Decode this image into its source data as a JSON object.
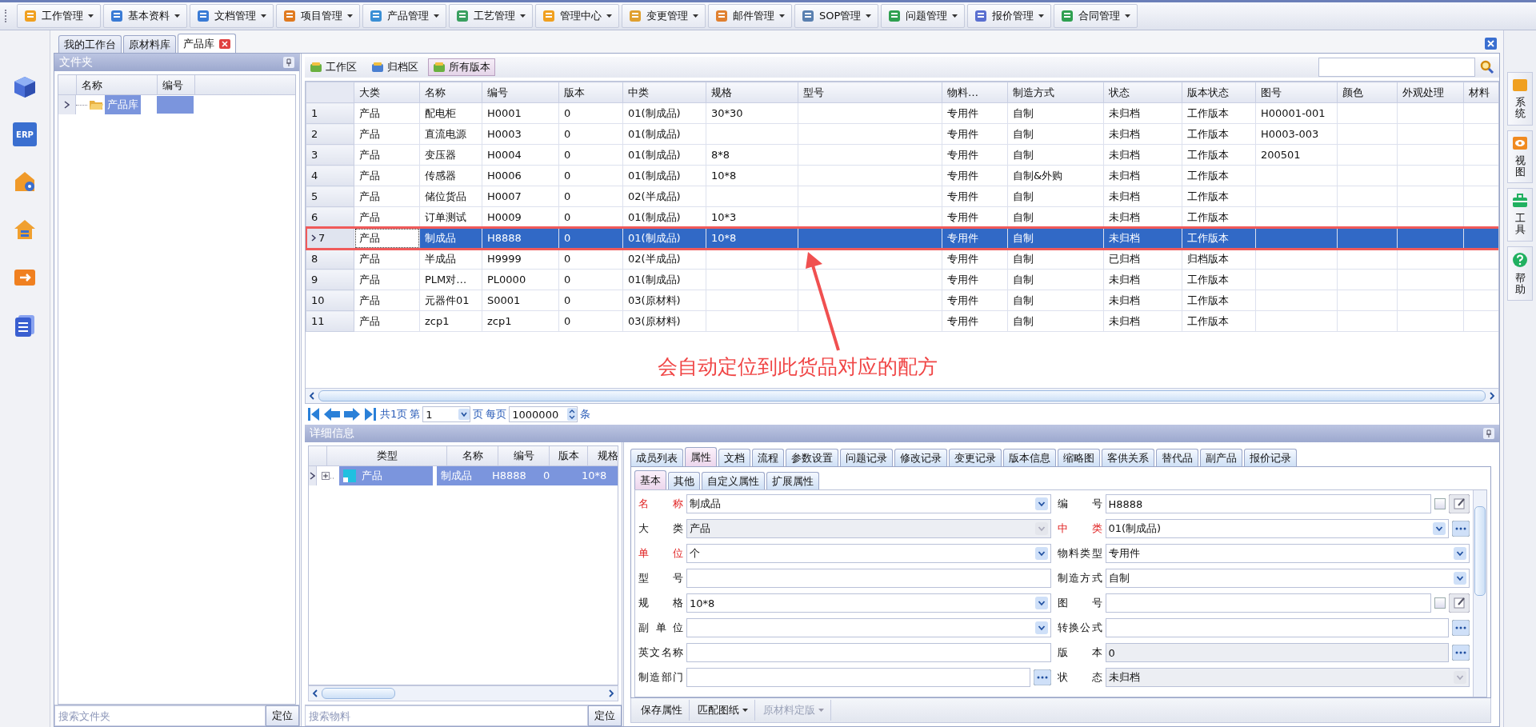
{
  "menu": [
    {
      "label": "工作管理"
    },
    {
      "label": "基本资料"
    },
    {
      "label": "文档管理"
    },
    {
      "label": "项目管理"
    },
    {
      "label": "产品管理"
    },
    {
      "label": "工艺管理"
    },
    {
      "label": "管理中心"
    },
    {
      "label": "变更管理"
    },
    {
      "label": "邮件管理"
    },
    {
      "label": "SOP管理"
    },
    {
      "label": "问题管理"
    },
    {
      "label": "报价管理"
    },
    {
      "label": "合同管理"
    }
  ],
  "left_bar": {
    "badge": "ERP"
  },
  "doc_tabs": [
    {
      "label": "我的工作台",
      "selected": false,
      "closable": false
    },
    {
      "label": "原材料库",
      "selected": false,
      "closable": false
    },
    {
      "label": "产品库",
      "selected": true,
      "closable": true
    }
  ],
  "folder_panel": {
    "title": "文件夹",
    "columns": [
      "名称",
      "编号"
    ],
    "tree": [
      {
        "label": "产品库",
        "selected": true
      }
    ],
    "search_placeholder": "搜索文件夹",
    "locate_button": "定位"
  },
  "toolbar": [
    {
      "label": "工作区",
      "selected": false
    },
    {
      "label": "归档区",
      "selected": false
    },
    {
      "label": "所有版本",
      "selected": true
    }
  ],
  "table": {
    "columns": [
      "大类",
      "名称",
      "编号",
      "版本",
      "中类",
      "规格",
      "型号",
      "物料…",
      "制造方式",
      "状态",
      "版本状态",
      "图号",
      "颜色",
      "外观处理",
      "材料"
    ],
    "rows": [
      {
        "num": "1",
        "selected": false,
        "highlighted": false,
        "cells": [
          "产品",
          "配电柜",
          "H0001",
          "0",
          "01(制成品)",
          "30*30",
          "",
          "专用件",
          "自制",
          "未归档",
          "工作版本",
          "H00001-001",
          "",
          "",
          ""
        ]
      },
      {
        "num": "2",
        "selected": false,
        "highlighted": false,
        "cells": [
          "产品",
          "直流电源",
          "H0003",
          "0",
          "01(制成品)",
          "",
          "",
          "专用件",
          "自制",
          "未归档",
          "工作版本",
          "H0003-003",
          "",
          "",
          ""
        ]
      },
      {
        "num": "3",
        "selected": false,
        "highlighted": false,
        "cells": [
          "产品",
          "变压器",
          "H0004",
          "0",
          "01(制成品)",
          "8*8",
          "",
          "专用件",
          "自制",
          "未归档",
          "工作版本",
          "200501",
          "",
          "",
          ""
        ]
      },
      {
        "num": "4",
        "selected": false,
        "highlighted": false,
        "cells": [
          "产品",
          "传感器",
          "H0006",
          "0",
          "01(制成品)",
          "10*8",
          "",
          "专用件",
          "自制&外购",
          "未归档",
          "工作版本",
          "",
          "",
          "",
          ""
        ]
      },
      {
        "num": "5",
        "selected": false,
        "highlighted": false,
        "cells": [
          "产品",
          "储位货品",
          "H0007",
          "0",
          "02(半成品)",
          "",
          "",
          "专用件",
          "自制",
          "未归档",
          "工作版本",
          "",
          "",
          "",
          ""
        ]
      },
      {
        "num": "6",
        "selected": false,
        "highlighted": false,
        "cells": [
          "产品",
          "订单测试",
          "H0009",
          "0",
          "01(制成品)",
          "10*3",
          "",
          "专用件",
          "自制",
          "未归档",
          "工作版本",
          "",
          "",
          "",
          ""
        ]
      },
      {
        "num": "7",
        "selected": true,
        "highlighted": true,
        "cells": [
          "产品",
          "制成品",
          "H8888",
          "0",
          "01(制成品)",
          "10*8",
          "",
          "专用件",
          "自制",
          "未归档",
          "工作版本",
          "",
          "",
          "",
          ""
        ]
      },
      {
        "num": "8",
        "selected": false,
        "highlighted": false,
        "cells": [
          "产品",
          "半成品",
          "H9999",
          "0",
          "02(半成品)",
          "",
          "",
          "专用件",
          "自制",
          "已归档",
          "归档版本",
          "",
          "",
          "",
          ""
        ]
      },
      {
        "num": "9",
        "selected": false,
        "highlighted": false,
        "cells": [
          "产品",
          "PLM对…",
          "PL0000",
          "0",
          "01(制成品)",
          "",
          "",
          "专用件",
          "自制",
          "未归档",
          "工作版本",
          "",
          "",
          "",
          ""
        ]
      },
      {
        "num": "10",
        "selected": false,
        "highlighted": false,
        "cells": [
          "产品",
          "元器件01",
          "S0001",
          "0",
          "03(原材料)",
          "",
          "",
          "专用件",
          "自制",
          "未归档",
          "工作版本",
          "",
          "",
          "",
          ""
        ]
      },
      {
        "num": "11",
        "selected": false,
        "highlighted": false,
        "cells": [
          "产品",
          "zcp1",
          "zcp1",
          "0",
          "03(原材料)",
          "",
          "",
          "专用件",
          "自制",
          "未归档",
          "工作版本",
          "",
          "",
          "",
          ""
        ]
      }
    ]
  },
  "annotation": {
    "text": "会自动定位到此货品对应的配方"
  },
  "pager": {
    "total": "共1页",
    "page_label": "第",
    "page": "1",
    "page_unit": "页",
    "per_page_label": "每页",
    "per_page": "1000000",
    "unit": "条"
  },
  "detail": {
    "title": "详细信息",
    "grid": {
      "columns": [
        "类型",
        "名称",
        "编号",
        "版本",
        "规格"
      ],
      "rows": [
        {
          "selected": true,
          "cells": [
            "产品",
            "制成品",
            "H8888",
            "0",
            "10*8"
          ]
        }
      ]
    },
    "search_placeholder": "搜索物料",
    "locate_button": "定位",
    "tabs": [
      {
        "label": "成员列表",
        "selected": false
      },
      {
        "label": "属性",
        "selected": true
      },
      {
        "label": "文档",
        "selected": false
      },
      {
        "label": "流程",
        "selected": false
      },
      {
        "label": "参数设置",
        "selected": false
      },
      {
        "label": "问题记录",
        "selected": false
      },
      {
        "label": "修改记录",
        "selected": false
      },
      {
        "label": "变更记录",
        "selected": false
      },
      {
        "label": "版本信息",
        "selected": false
      },
      {
        "label": "缩略图",
        "selected": false
      },
      {
        "label": "客供关系",
        "selected": false
      },
      {
        "label": "替代品",
        "selected": false
      },
      {
        "label": "副产品",
        "selected": false
      },
      {
        "label": "报价记录",
        "selected": false
      }
    ],
    "subtabs": [
      {
        "label": "基本",
        "selected": true
      },
      {
        "label": "其他",
        "selected": false
      },
      {
        "label": "自定义属性",
        "selected": false
      },
      {
        "label": "扩展属性",
        "selected": false
      }
    ],
    "fields": [
      {
        "label": "名称",
        "required": true,
        "value": "制成品",
        "kind": "combo",
        "disabled": false
      },
      {
        "label": "编号",
        "required": false,
        "value": "H8888",
        "kind": "text_edit",
        "disabled": false,
        "checked": false
      },
      {
        "label": "大类",
        "required": false,
        "value": "产品",
        "kind": "combo",
        "disabled": true
      },
      {
        "label": "中类",
        "required": true,
        "value": "01(制成品)",
        "kind": "combo_ellipsis",
        "disabled": false
      },
      {
        "label": "单位",
        "required": true,
        "value": "个",
        "kind": "combo",
        "disabled": false
      },
      {
        "label": "物料类型",
        "required": false,
        "value": "专用件",
        "kind": "combo",
        "disabled": false
      },
      {
        "label": "型号",
        "required": false,
        "kind": "text",
        "disabled": false
      },
      {
        "label": "制造方式",
        "required": false,
        "value": "自制",
        "kind": "combo",
        "disabled": false
      },
      {
        "label": "规格",
        "required": false,
        "value": "10*8",
        "kind": "combo",
        "disabled": false
      },
      {
        "label": "图号",
        "required": false,
        "kind": "text_edit",
        "disabled": false,
        "checked": false
      },
      {
        "label": "副单位",
        "required": false,
        "kind": "combo",
        "disabled": false
      },
      {
        "label": "转换公式",
        "required": false,
        "kind": "ellipsis",
        "disabled": false
      },
      {
        "label": "英文名称",
        "required": false,
        "kind": "text",
        "disabled": false
      },
      {
        "label": "版本",
        "required": false,
        "value": "0",
        "kind": "ellipsis",
        "disabled": true
      },
      {
        "label": "制造部门",
        "required": false,
        "kind": "ellipsis",
        "disabled": false
      },
      {
        "label": "状态",
        "required": false,
        "value": "未归档",
        "kind": "combo",
        "disabled": true
      }
    ],
    "actions": [
      {
        "label": "保存属性",
        "dropdown": false,
        "disabled": false
      },
      {
        "label": "匹配图纸",
        "dropdown": true,
        "disabled": false
      },
      {
        "label": "原材料定版",
        "dropdown": true,
        "disabled": true
      }
    ]
  },
  "right_bar": [
    {
      "label": "系统",
      "kind": "folder"
    },
    {
      "label": "视图",
      "kind": "eye"
    },
    {
      "label": "工具",
      "kind": "toolbox"
    },
    {
      "label": "帮助",
      "kind": "help"
    }
  ]
}
